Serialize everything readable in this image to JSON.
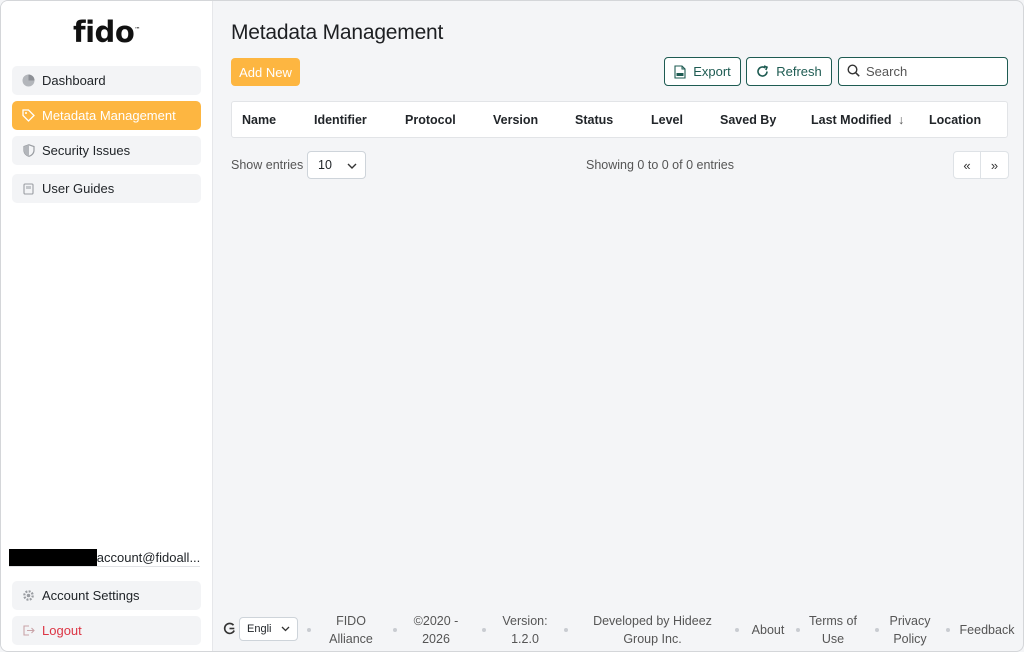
{
  "app": {
    "logo": "fido"
  },
  "sidebar": {
    "items": [
      {
        "label": "Dashboard",
        "icon": "pie-chart-icon"
      },
      {
        "label": "Metadata Management",
        "icon": "tag-icon",
        "active": true
      },
      {
        "label": "Security Issues",
        "icon": "shield-icon"
      },
      {
        "label": "User Guides",
        "icon": "book-icon"
      }
    ],
    "user_email": "account@fidoall...",
    "account_settings": "Account Settings",
    "logout": "Logout"
  },
  "page": {
    "title": "Metadata Management",
    "add_new": "Add New",
    "export": "Export",
    "refresh": "Refresh",
    "search_placeholder": "Search"
  },
  "table": {
    "columns": [
      "Name",
      "Identifier",
      "Protocol",
      "Version",
      "Status",
      "Level",
      "Saved By",
      "Last Modified",
      "Location"
    ],
    "sorted_column": "Last Modified",
    "sort_indicator": "↓",
    "show_entries_label": "Show entries",
    "entries_value": "10",
    "showing_text": "Showing 0 to 0 of 0 entries",
    "prev": "«",
    "next": "»"
  },
  "footer": {
    "language": "Engli",
    "fido_alliance": [
      "FIDO",
      "Alliance"
    ],
    "copyright": [
      "©2020 -",
      "2026"
    ],
    "version": [
      "Version:",
      "1.2.0"
    ],
    "developed_by": [
      "Developed by Hideez",
      "Group Inc."
    ],
    "about": "About",
    "terms": [
      "Terms of",
      "Use"
    ],
    "privacy": [
      "Privacy",
      "Policy"
    ],
    "feedback": "Feedback"
  },
  "colors": {
    "accent": "#fdb641",
    "outline": "#1e5b52",
    "danger": "#dc3545"
  }
}
